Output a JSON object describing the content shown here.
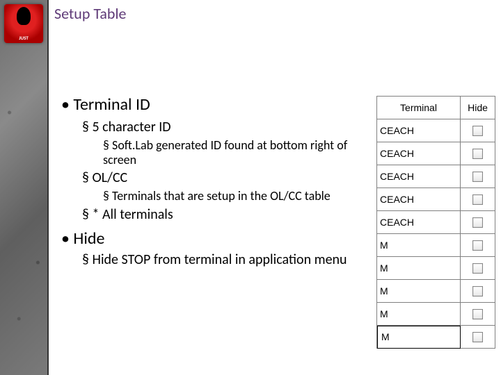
{
  "logo": {
    "text": "JUST"
  },
  "title": "Setup Table",
  "bullets": {
    "terminal_id": "Terminal ID",
    "five_char": "5 character ID",
    "softlab": "Soft.Lab generated ID found at bottom right of screen",
    "olcc": "OL/CC",
    "olcc_desc": "Terminals that are setup in the OL/CC table",
    "all_terminals": "* All terminals",
    "hide": "Hide",
    "hide_desc": "Hide STOP from terminal in application menu"
  },
  "table": {
    "headers": {
      "terminal": "Terminal",
      "hide": "Hide"
    },
    "rows": [
      {
        "terminal": "CEACH",
        "hide": false,
        "editing": false
      },
      {
        "terminal": "CEACH",
        "hide": false,
        "editing": false
      },
      {
        "terminal": "CEACH",
        "hide": false,
        "editing": false
      },
      {
        "terminal": "CEACH",
        "hide": false,
        "editing": false
      },
      {
        "terminal": "CEACH",
        "hide": false,
        "editing": false
      },
      {
        "terminal": "M",
        "hide": false,
        "editing": false
      },
      {
        "terminal": "M",
        "hide": false,
        "editing": false
      },
      {
        "terminal": "M",
        "hide": false,
        "editing": false
      },
      {
        "terminal": "M",
        "hide": false,
        "editing": false
      },
      {
        "terminal": "M",
        "hide": false,
        "editing": true
      }
    ]
  },
  "chart_data": {
    "type": "table",
    "title": "Setup Table",
    "headers": [
      "Terminal",
      "Hide"
    ],
    "rows": [
      [
        "CEACH",
        false
      ],
      [
        "CEACH",
        false
      ],
      [
        "CEACH",
        false
      ],
      [
        "CEACH",
        false
      ],
      [
        "CEACH",
        false
      ],
      [
        "M",
        false
      ],
      [
        "M",
        false
      ],
      [
        "M",
        false
      ],
      [
        "M",
        false
      ],
      [
        "M",
        false
      ]
    ]
  }
}
